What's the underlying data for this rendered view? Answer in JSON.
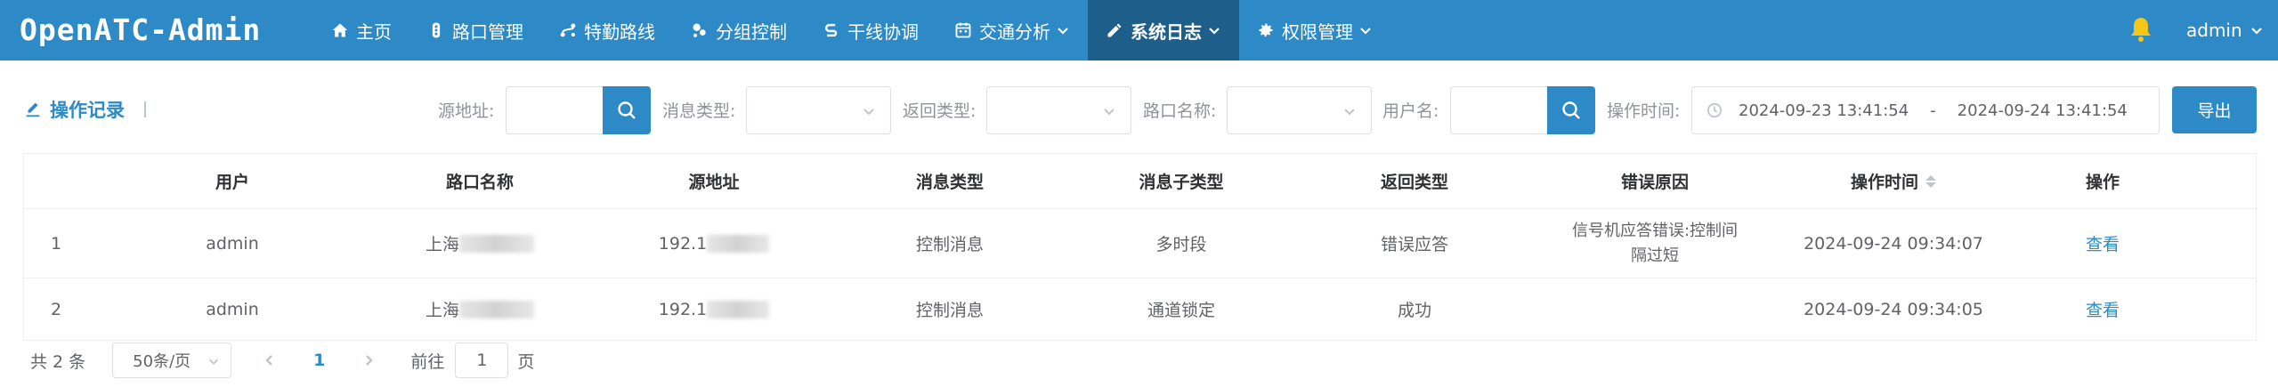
{
  "app": {
    "brand": "OpenATC-Admin"
  },
  "nav": {
    "items": [
      {
        "label": "主页",
        "icon": "home-icon"
      },
      {
        "label": "路口管理",
        "icon": "traffic-light-icon"
      },
      {
        "label": "特勤路线",
        "icon": "route-icon"
      },
      {
        "label": "分组控制",
        "icon": "group-icon"
      },
      {
        "label": "干线协调",
        "icon": "coordination-icon"
      },
      {
        "label": "交通分析",
        "icon": "analysis-icon",
        "dropdown": true
      },
      {
        "label": "系统日志",
        "icon": "log-edit-icon",
        "dropdown": true,
        "active": true
      },
      {
        "label": "权限管理",
        "icon": "gear-icon",
        "dropdown": true
      }
    ],
    "user": "admin"
  },
  "filters": {
    "page_title": "操作记录",
    "source_label": "源地址:",
    "msg_type_label": "消息类型:",
    "return_type_label": "返回类型:",
    "crossing_label": "路口名称:",
    "username_label": "用户名:",
    "time_label": "操作时间:",
    "time_start": "2024-09-23 13:41:54",
    "time_sep": "-",
    "time_end": "2024-09-24 13:41:54",
    "export": "导出"
  },
  "table": {
    "headers": {
      "user": "用户",
      "crossing": "路口名称",
      "source": "源地址",
      "msg_type": "消息类型",
      "msg_subtype": "消息子类型",
      "return_type": "返回类型",
      "error": "错误原因",
      "time": "操作时间",
      "action": "操作"
    },
    "rows": [
      {
        "index": "1",
        "user": "admin",
        "crossing": "上海",
        "source": "192.1",
        "msg_type": "控制消息",
        "msg_subtype": "多时段",
        "return_type": "错误应答",
        "error": "信号机应答错误:控制间隔过短",
        "time": "2024-09-24 09:34:07",
        "action": "查看"
      },
      {
        "index": "2",
        "user": "admin",
        "crossing": "上海",
        "source": "192.1",
        "msg_type": "控制消息",
        "msg_subtype": "通道锁定",
        "return_type": "成功",
        "error": "",
        "time": "2024-09-24 09:34:05",
        "action": "查看"
      }
    ]
  },
  "pagination": {
    "total": "共 2 条",
    "page_size": "50条/页",
    "current_page": "1",
    "goto_label": "前往",
    "goto_value": "1",
    "page_suffix": "页"
  },
  "colors": {
    "primary": "#2d8ac6",
    "nav_active": "#1d5e8a",
    "bell": "#f5c518"
  }
}
